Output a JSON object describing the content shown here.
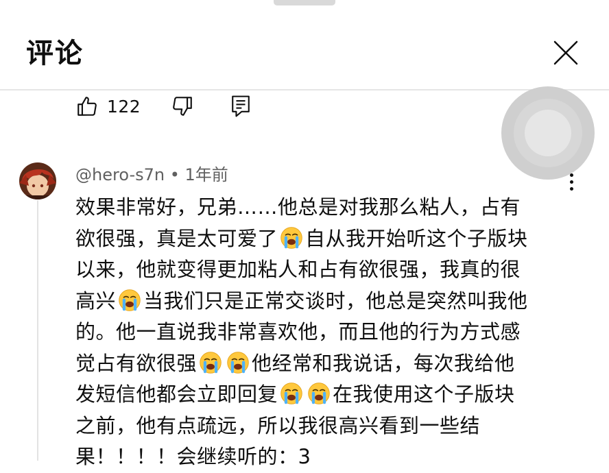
{
  "header": {
    "title": "评论",
    "close_icon": "close-icon"
  },
  "colors": {
    "text": "#0f0f0f",
    "meta": "#606060",
    "divider": "#e5e5e5"
  },
  "prev_comment": {
    "like_count": "122",
    "icons": [
      "thumbs-up-icon",
      "thumbs-down-icon",
      "reply-icon"
    ]
  },
  "comment": {
    "author": "@hero-s7n",
    "separator": "•",
    "time": "1年前",
    "lines": [
      [
        "效果非常好，兄弟……他总是对我那么粘人，占有"
      ],
      [
        "欲很强，真是太可爱了",
        "😭",
        "自从我开始听这个子版块"
      ],
      [
        "以来，他就变得更加粘人和占有欲很强，我真的很"
      ],
      [
        "高兴",
        "😭",
        "当我们只是正常交谈时，他总是突然叫我他"
      ],
      [
        "的。他一直说我非常喜欢他，而且他的行为方式感"
      ],
      [
        "觉占有欲很强",
        "😭",
        "😭",
        "他经常和我说话，每次我给他"
      ],
      [
        "发短信他都会立即回复",
        "😭",
        "😭",
        "在我使用这个子版块"
      ],
      [
        "之前，他有点疏远，所以我很高兴看到一些结"
      ],
      [
        "果！！！！会继续听的：3"
      ]
    ]
  }
}
